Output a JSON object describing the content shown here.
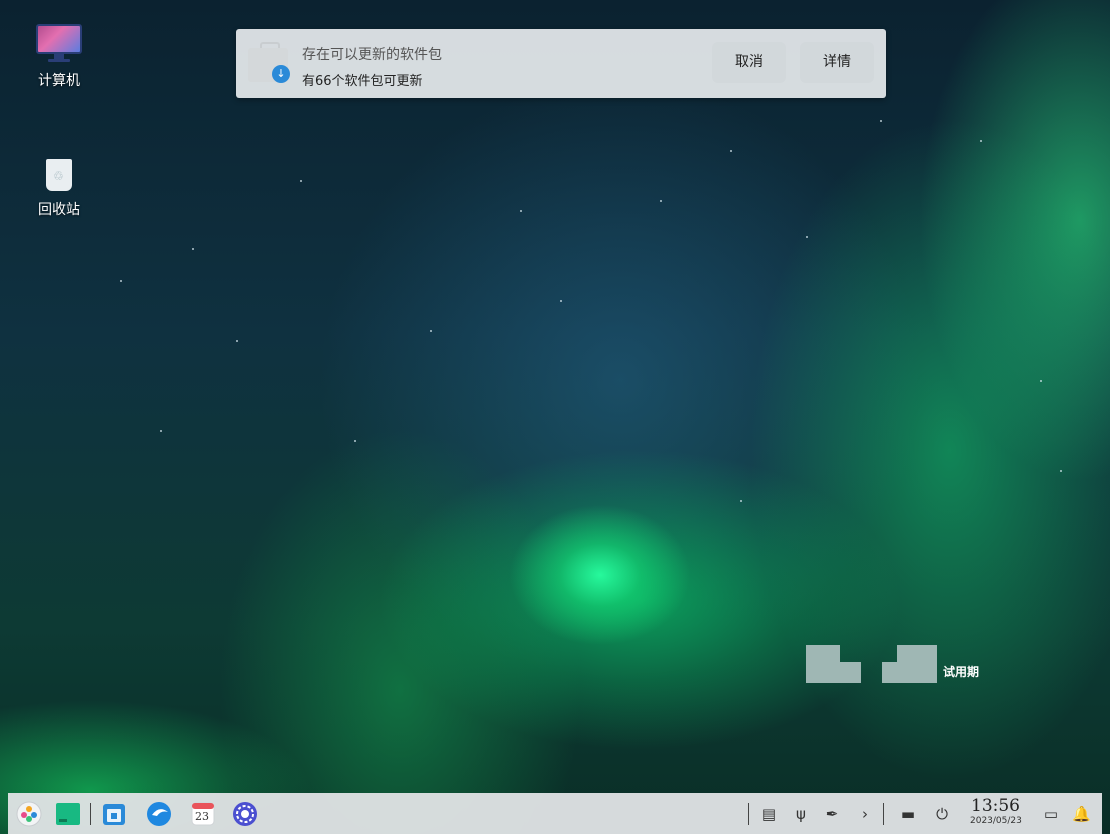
{
  "desktop": {
    "icons": [
      {
        "label": "计算机",
        "icon": "computer-icon"
      },
      {
        "label": "回收站",
        "icon": "trash-icon"
      }
    ]
  },
  "notification": {
    "title": "存在可以更新的软件包",
    "body": "有66个软件包可更新",
    "cancel_label": "取消",
    "details_label": "详情",
    "app_icon": "package-update-icon"
  },
  "trial": {
    "label": "试用期"
  },
  "taskbar": {
    "apps": [
      {
        "name": "launcher-icon"
      },
      {
        "name": "multitask-view-icon"
      },
      {
        "name": "file-manager-icon"
      },
      {
        "name": "browser-icon"
      },
      {
        "name": "calendar-icon",
        "text": "23"
      },
      {
        "name": "settings-icon"
      }
    ],
    "tray": [
      {
        "name": "keyboard-icon"
      },
      {
        "name": "usb-icon"
      },
      {
        "name": "pen-icon"
      },
      {
        "name": "expand-tray-icon",
        "glyph": "›"
      }
    ],
    "clock": {
      "time": "13:56",
      "date": "2023/05/23"
    }
  },
  "colors": {
    "taskbar_bg": "#e1e4e6",
    "notification_bg": "#e8ecee",
    "aurora_green": "#28ffa0"
  }
}
